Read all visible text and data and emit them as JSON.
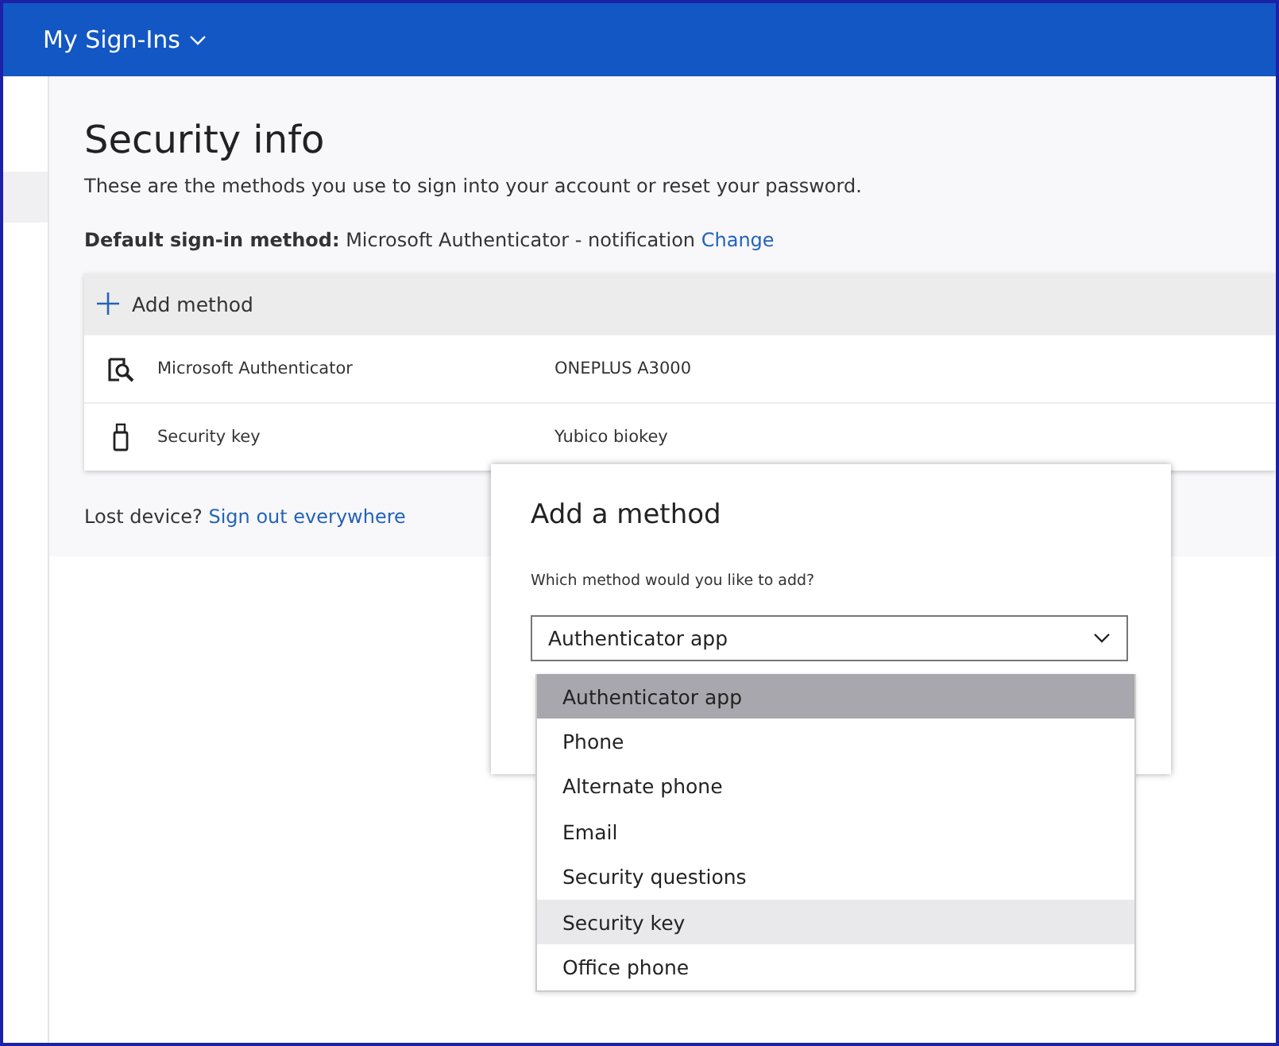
{
  "header": {
    "title": "My Sign-Ins"
  },
  "page": {
    "title": "Security info",
    "description": "These are the methods you use to sign into your account or reset your password.",
    "default_method_label": "Default sign-in method:",
    "default_method_value": "Microsoft Authenticator - notification",
    "change_link": "Change"
  },
  "methods": {
    "add_label": "Add method",
    "rows": [
      {
        "kind": "authenticator",
        "name": "Microsoft Authenticator",
        "detail": "ONEPLUS A3000"
      },
      {
        "kind": "key",
        "name": "Security key",
        "detail": "Yubico biokey"
      }
    ]
  },
  "lost_device": {
    "text": "Lost device?",
    "link": "Sign out everywhere"
  },
  "dialog": {
    "title": "Add a method",
    "question": "Which method would you like to add?",
    "value": "Authenticator app",
    "options": [
      {
        "label": "Authenticator app",
        "selected": true,
        "hovered": false
      },
      {
        "label": "Phone",
        "selected": false,
        "hovered": false
      },
      {
        "label": "Alternate phone",
        "selected": false,
        "hovered": false
      },
      {
        "label": "Email",
        "selected": false,
        "hovered": false
      },
      {
        "label": "Security questions",
        "selected": false,
        "hovered": false
      },
      {
        "label": "Security key",
        "selected": false,
        "hovered": true
      },
      {
        "label": "Office phone",
        "selected": false,
        "hovered": false
      }
    ]
  }
}
